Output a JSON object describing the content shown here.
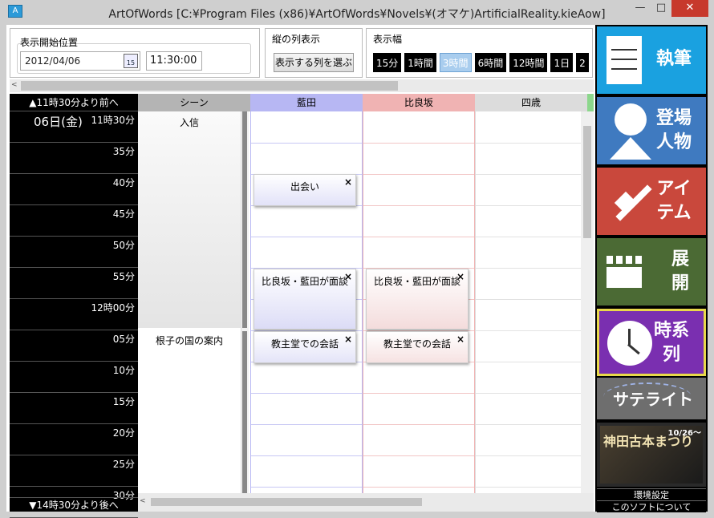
{
  "window": {
    "title": "ArtOfWords [C:¥Program Files (x86)¥ArtOfWords¥Novels¥(オマケ)ArtificialReality.kieAow]",
    "icon": "app-icon",
    "min_label": "—",
    "max_label": "□",
    "close_label": "✕"
  },
  "controls": {
    "start_position_label": "表示開始位置",
    "date_value": "2012/04/06",
    "calendar_day": "15",
    "time_value": "11:30:00",
    "columns_label": "縦の列表示",
    "choose_columns_button": "表示する列を選ぶ",
    "range_label": "表示幅",
    "ranges": [
      "15分",
      "1時間",
      "3時間",
      "6時間",
      "12時間",
      "1日",
      "2"
    ],
    "active_range": "3時間"
  },
  "timeline": {
    "earlier_button": "▲11時30分より前へ",
    "later_button": "▼14時30分より後へ",
    "date_label": "06日(金)",
    "rows": [
      "11時30分",
      "35分",
      "40分",
      "45分",
      "50分",
      "55分",
      "12時00分",
      "05分",
      "10分",
      "15分",
      "20分",
      "25分",
      "30分"
    ]
  },
  "columns": [
    {
      "name": "シーン",
      "color": "#b4b4b4"
    },
    {
      "name": "藍田",
      "color": "#b7b7f3"
    },
    {
      "name": "比良坂",
      "color": "#f0b3b3"
    },
    {
      "name": "四歳",
      "color": "#dcdcdc"
    }
  ],
  "scenes": [
    {
      "label": "入信"
    },
    {
      "label": "根子の国の案内"
    }
  ],
  "events": {
    "aida": [
      {
        "label": "出会い"
      },
      {
        "label": "比良坂・藍田が面談"
      },
      {
        "label": "教主堂での会話"
      }
    ],
    "hirasaka": [
      {
        "label": "比良坂・藍田が面談"
      },
      {
        "label": "教主堂での会話"
      }
    ],
    "close_glyph": "×"
  },
  "sidebar": {
    "items": [
      {
        "label": "執筆",
        "bg": "#1aa1e0",
        "icon": "document-icon"
      },
      {
        "label": "登場人物",
        "bg": "#3f7ac0",
        "icon": "person-icon"
      },
      {
        "label": "アイテム",
        "bg": "#c9483c",
        "icon": "sword-icon"
      },
      {
        "label": "展開",
        "bg": "#4b6a34",
        "icon": "clapperboard-icon"
      },
      {
        "label": "時系列",
        "bg": "#7a2fb0",
        "icon": "clock-icon"
      },
      {
        "label": "サテライト",
        "bg": "#6e6e6e",
        "icon": "satellite-icon"
      },
      {
        "label": "神田古本まつり",
        "sublabel": "10/26〜",
        "bg": "#2a2a2a",
        "icon": "banner-icon"
      }
    ],
    "settings": "環境設定",
    "about": "このソフトについて"
  }
}
